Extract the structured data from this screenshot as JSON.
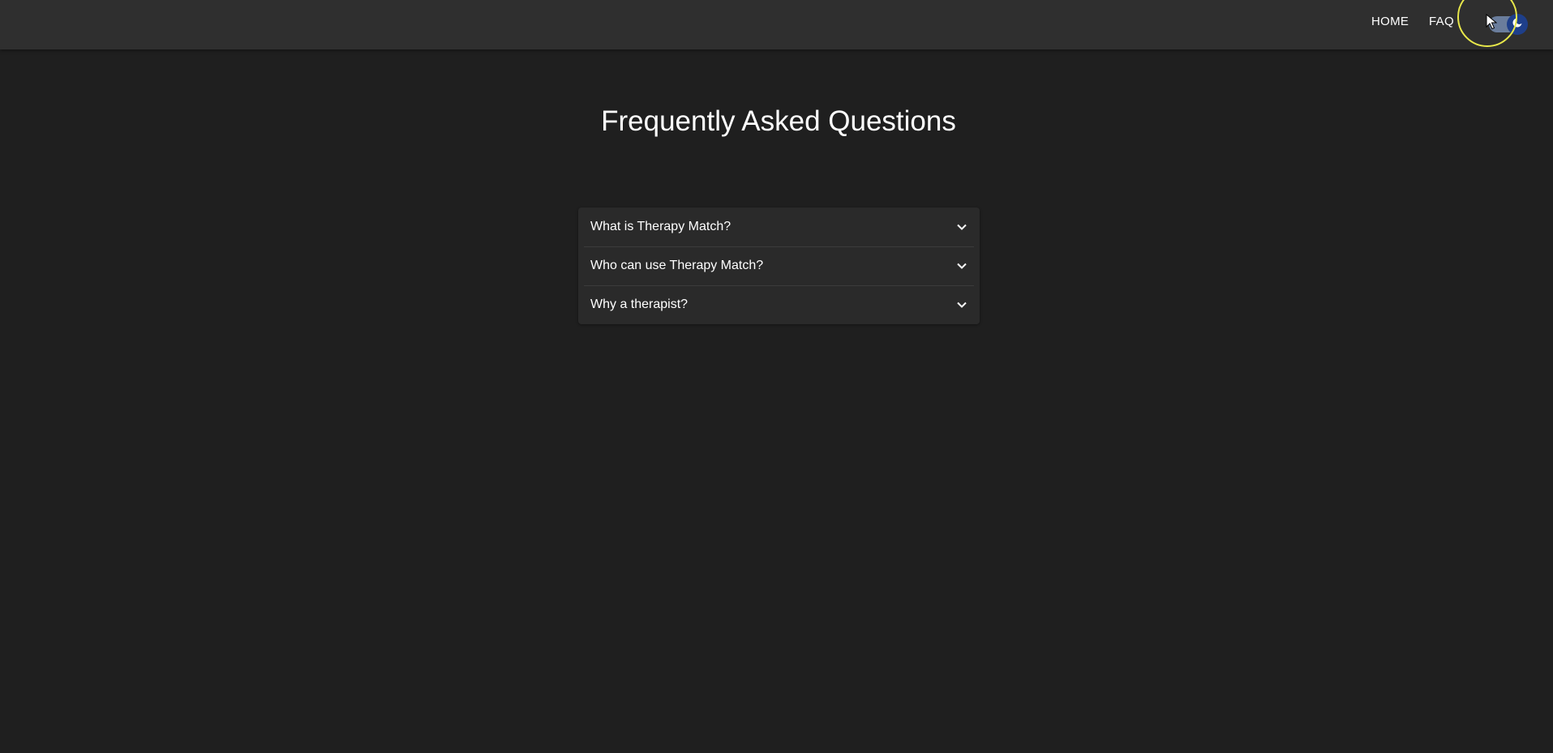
{
  "nav": {
    "home_label": "HOME",
    "faq_label": "FAQ"
  },
  "theme_toggle": {
    "mode": "dark",
    "icon": "moon-icon",
    "track_color": "#6a7d9c",
    "knob_color": "#1e3f8a"
  },
  "page": {
    "title": "Frequently Asked Questions"
  },
  "faq": {
    "items": [
      {
        "question": "What is Therapy Match?",
        "expanded": false
      },
      {
        "question": "Who can use Therapy Match?",
        "expanded": false
      },
      {
        "question": "Why a therapist?",
        "expanded": false
      }
    ]
  },
  "colors": {
    "background": "#1f1f1f",
    "topbar": "#2f2f2f",
    "card": "#2a2a2a",
    "cursor_highlight": "#e8e84a"
  }
}
